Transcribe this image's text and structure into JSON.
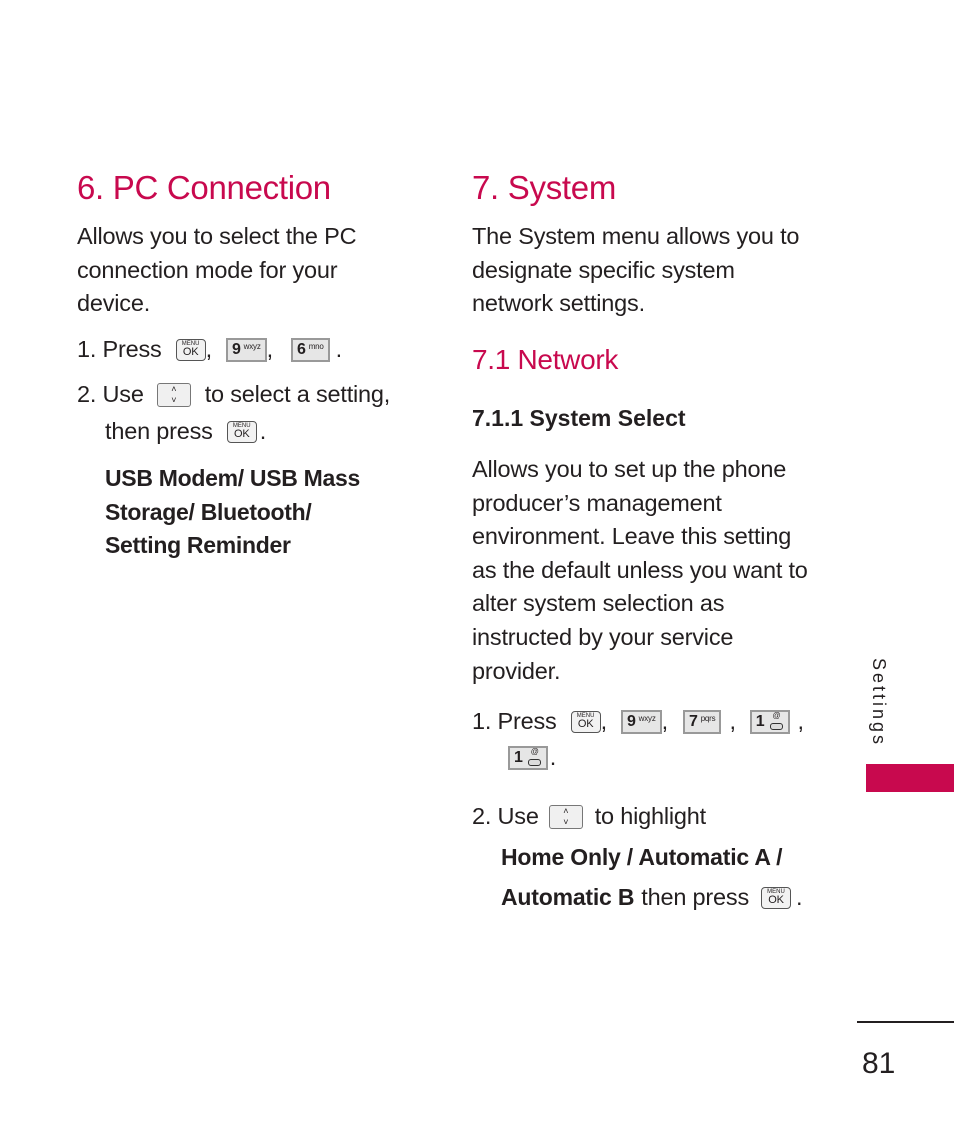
{
  "colors": {
    "accent": "#c8094e",
    "text": "#231f20"
  },
  "left": {
    "title": "6. PC Connection",
    "intro": "Allows you to select the PC connection mode for your device.",
    "intro_lines": [
      "Allows you to select the PC",
      "connection mode for your",
      "device."
    ],
    "step1": {
      "prefix": "1. Press",
      "keys": [
        {
          "type": "menu-ok",
          "top": "MENU",
          "main": "OK"
        },
        {
          "type": "number",
          "digit": "9",
          "letters": "wxyz"
        },
        {
          "type": "number",
          "digit": "6",
          "letters": "mno"
        }
      ]
    },
    "step2": {
      "prefix": "2. Use",
      "suffix": "to select a setting,",
      "line2": "then press"
    },
    "options_lines": [
      "USB Modem/ USB Mass",
      "Storage/ Bluetooth/",
      "Setting Reminder"
    ]
  },
  "right": {
    "title": "7. System",
    "intro_lines": [
      "The System menu allows you to",
      "designate specific system",
      "network settings."
    ],
    "subsection": "7.1 Network",
    "subsubsection": "7.1.1 System Select",
    "body_lines": [
      "Allows you to set up the phone",
      "producer’s management",
      "environment. Leave this setting",
      "as the default unless you want to",
      "alter system selection as",
      "instructed by your service",
      "provider."
    ],
    "step1": {
      "prefix": "1. Press",
      "keys": [
        {
          "type": "menu-ok",
          "top": "MENU",
          "main": "OK"
        },
        {
          "type": "number",
          "digit": "9",
          "letters": "wxyz"
        },
        {
          "type": "number",
          "digit": "7",
          "letters": "pqrs"
        },
        {
          "type": "number",
          "digit": "1",
          "letters": "voicemail"
        },
        {
          "type": "number",
          "digit": "1",
          "letters": "voicemail"
        }
      ]
    },
    "step2": {
      "prefix": "2. Use",
      "suffix": "to highlight",
      "option1": "Home Only / Automatic A /",
      "option2": "Automatic B",
      "then": "then press"
    }
  },
  "key_labels": {
    "menu": "MENU",
    "ok": "OK",
    "up": "˄",
    "down": "˅",
    "at": "@"
  },
  "punct": {
    "comma": ",",
    "period": "."
  },
  "side_tab": {
    "label": "Settings"
  },
  "footer": {
    "page_number": "81"
  }
}
